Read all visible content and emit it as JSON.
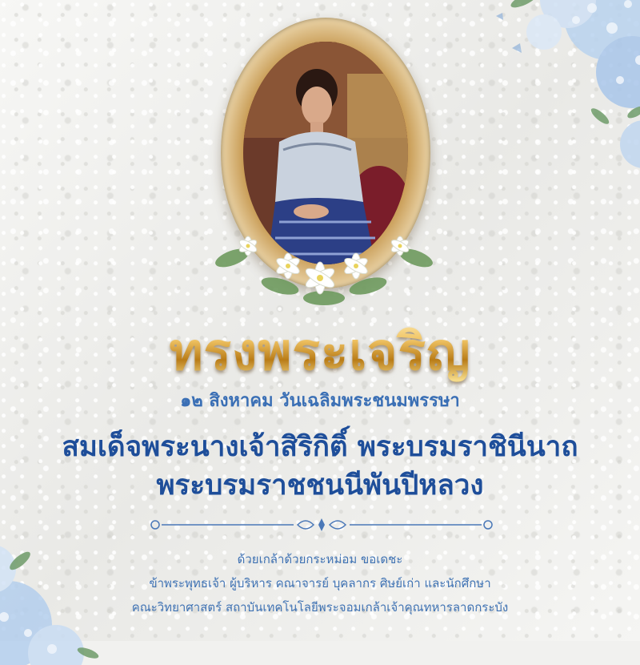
{
  "title": "ทรงพระเจริญ",
  "subtitle": "๑๒ สิงหาคม วันเฉลิมพระชนมพรรษา",
  "royal_name": {
    "line1": "สมเด็จพระนางเจ้าสิริกิติ์ พระบรมราชินีนาถ",
    "line2": "พระบรมราชชนนีพันปีหลวง"
  },
  "footer": {
    "line1": "ด้วยเกล้าด้วยกระหม่อม ขอเดชะ",
    "line2": "ข้าพระพุทธเจ้า ผู้บริหาร คณาจารย์ บุคลากร ศิษย์เก่า และนักศึกษา",
    "line3": "คณะวิทยาศาสตร์ สถาบันเทคโนโลยีพระจอมเกล้าเจ้าคุณทหารลาดกระบัง"
  },
  "colors": {
    "title_gold": "#d7a13c",
    "subtitle_blue": "#3a6fb5",
    "name_blue": "#1e4e9a",
    "footer_blue": "#3f72b3",
    "background": "#f1f1ef"
  }
}
